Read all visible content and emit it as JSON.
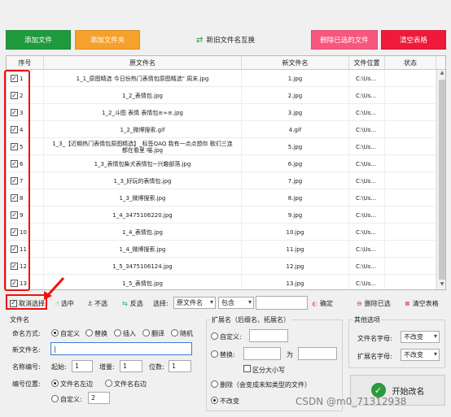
{
  "toolbar": {
    "add_file": "添加文件",
    "add_folder": "添加文件夹",
    "swap": "新旧文件名互换",
    "delete_selected": "删除已选的文件",
    "clear_table": "清空表格"
  },
  "colors": {
    "green": "#1f9a3c",
    "orange": "#f5a12c",
    "pink": "#f7567d",
    "red": "#f1193a"
  },
  "table": {
    "headers": {
      "idx": "序号",
      "orig": "原文件名",
      "new": "新文件名",
      "loc": "文件位置",
      "status": "状态"
    },
    "rows": [
      {
        "n": "1",
        "orig": "1_1_原图精选  今日份热门表情包原图精选\" 周末.jpg",
        "new": "1.jpg",
        "loc": "C:\\Us..."
      },
      {
        "n": "2",
        "orig": "1_2_表情包.jpg",
        "new": "2.jpg",
        "loc": "C:\\Us..."
      },
      {
        "n": "3",
        "orig": "1_2_斗图 表情 表情包≡∞≡.jpg",
        "new": "3.jpg",
        "loc": "C:\\Us..."
      },
      {
        "n": "4",
        "orig": "1_2_微博搜索.gif",
        "new": "4.gif",
        "loc": "C:\\Us..."
      },
      {
        "n": "5",
        "orig": "1_3_【近期热门表情包原图精选】_标签QAQ 我有一点点想你 歌们三连 都在看里 喵.jpg",
        "new": "5.jpg",
        "loc": "C:\\Us..."
      },
      {
        "n": "6",
        "orig": "1_3_表情包柴犬表情包~兴趣部落.jpg",
        "new": "6.jpg",
        "loc": "C:\\Us..."
      },
      {
        "n": "7",
        "orig": "1_3_好玩的表情包.jpg",
        "new": "7.jpg",
        "loc": "C:\\Us..."
      },
      {
        "n": "8",
        "orig": "1_3_微博搜索.jpg",
        "new": "8.jpg",
        "loc": "C:\\Us..."
      },
      {
        "n": "9",
        "orig": "1_4_3475106220.jpg",
        "new": "9.jpg",
        "loc": "C:\\Us..."
      },
      {
        "n": "10",
        "orig": "1_4_表情包.jpg",
        "new": "10.jpg",
        "loc": "C:\\Us..."
      },
      {
        "n": "11",
        "orig": "1_4_微博搜索.jpg",
        "new": "11.jpg",
        "loc": "C:\\Us..."
      },
      {
        "n": "12",
        "orig": "1_5_3475106124.jpg",
        "new": "12.jpg",
        "loc": "C:\\Us..."
      },
      {
        "n": "13",
        "orig": "1_5_表情包.jpg",
        "new": "13.jpg",
        "loc": "C:\\Us..."
      }
    ]
  },
  "bar": {
    "deselect": "取消选择",
    "select": "选中",
    "unselect": "不选",
    "invert": "反选",
    "choose": "选择:",
    "mode": "原文件名",
    "op": "包含",
    "confirm": "确定",
    "del_selected": "删除已选",
    "clear": "清空表格"
  },
  "filename": {
    "title": "文件名",
    "mode_label": "命名方式:",
    "custom": "自定义",
    "replace": "替换",
    "insert": "插入",
    "translate": "翻译",
    "random": "随机",
    "new_label": "新文件名:",
    "num_label": "名称编号:",
    "start_label": "起始:",
    "start": "1",
    "inc_label": "增量:",
    "inc": "1",
    "digits_label": "位数:",
    "digits": "1",
    "pos_label": "编号位置:",
    "left": "文件名左边",
    "right": "文件名右边",
    "custom_pos": "自定义:",
    "custom_pos_val": "2"
  },
  "ext": {
    "title": "扩展名（后缀名、拓展名）",
    "custom": "自定义:",
    "replace": "替换:",
    "as": "为",
    "case": "区分大小写",
    "remove": "删除（会变成未知类型的文件）",
    "keep": "不改变"
  },
  "other": {
    "title": "其他选项",
    "fn_case": "文件名字母:",
    "fn_case_val": "不改变",
    "ext_case": "扩展名字母:",
    "ext_case_val": "不改变"
  },
  "start_btn": "开始改名",
  "watermark": "CSDN @m0_71312938"
}
